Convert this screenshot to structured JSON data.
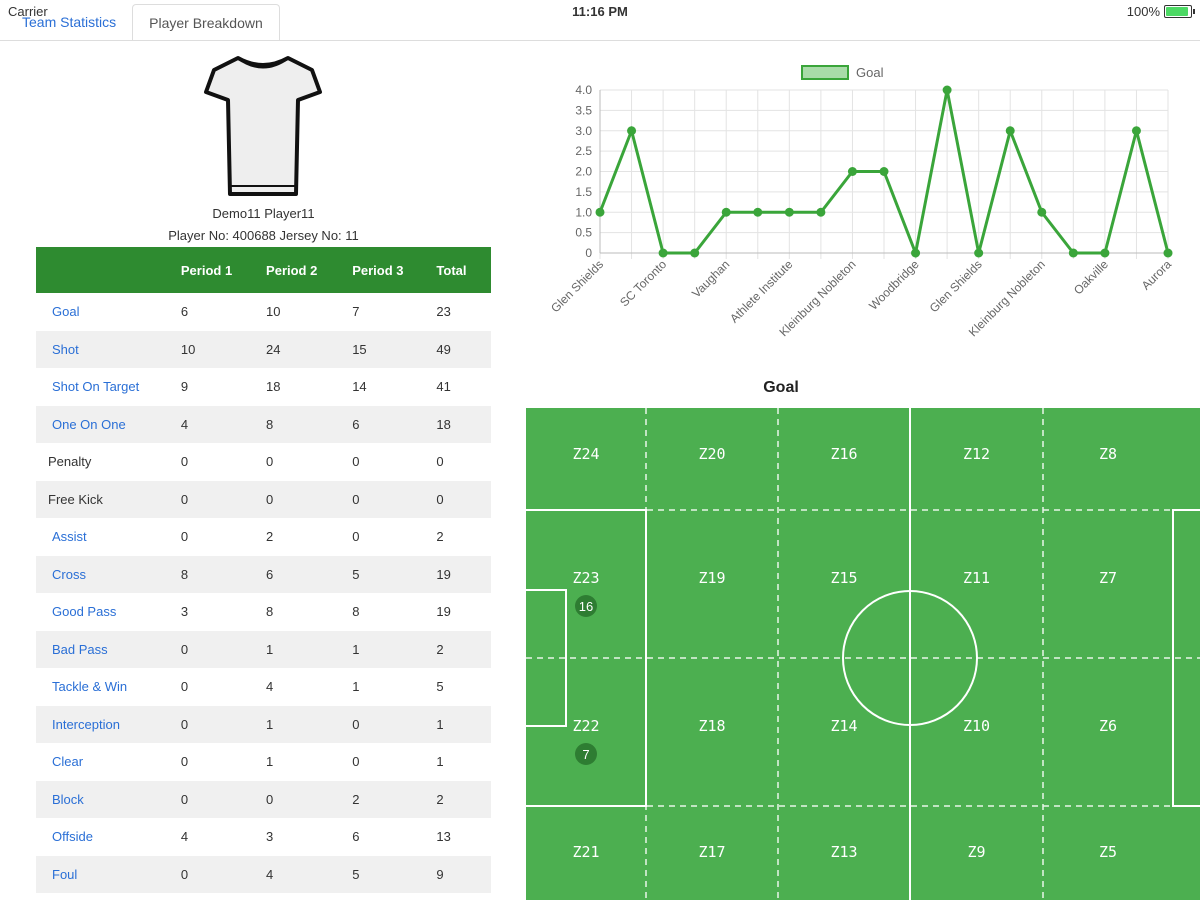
{
  "status": {
    "carrier": "Carrier",
    "time": "11:16 PM",
    "battery": "100%"
  },
  "tabs": [
    "Team Statistics",
    "Player Breakdown"
  ],
  "player": {
    "name": "Demo11 Player11",
    "info": "Player No: 400688 Jersey No: 11"
  },
  "table": {
    "headers": [
      "",
      "Period 1",
      "Period 2",
      "Period 3",
      "Total"
    ],
    "rows": [
      {
        "label": "Goal",
        "link": true,
        "values": [
          "6",
          "10",
          "7",
          "23"
        ]
      },
      {
        "label": "Shot",
        "link": true,
        "values": [
          "10",
          "24",
          "15",
          "49"
        ]
      },
      {
        "label": "Shot On Target",
        "link": true,
        "values": [
          "9",
          "18",
          "14",
          "41"
        ]
      },
      {
        "label": "One On One",
        "link": true,
        "values": [
          "4",
          "8",
          "6",
          "18"
        ]
      },
      {
        "label": "Penalty",
        "link": false,
        "values": [
          "0",
          "0",
          "0",
          "0"
        ]
      },
      {
        "label": "Free Kick",
        "link": false,
        "values": [
          "0",
          "0",
          "0",
          "0"
        ]
      },
      {
        "label": "Assist",
        "link": true,
        "values": [
          "0",
          "2",
          "0",
          "2"
        ]
      },
      {
        "label": "Cross",
        "link": true,
        "values": [
          "8",
          "6",
          "5",
          "19"
        ]
      },
      {
        "label": "Good Pass",
        "link": true,
        "values": [
          "3",
          "8",
          "8",
          "19"
        ]
      },
      {
        "label": "Bad Pass",
        "link": true,
        "values": [
          "0",
          "1",
          "1",
          "2"
        ]
      },
      {
        "label": "Tackle & Win",
        "link": true,
        "values": [
          "0",
          "4",
          "1",
          "5"
        ]
      },
      {
        "label": "Interception",
        "link": true,
        "values": [
          "0",
          "1",
          "0",
          "1"
        ]
      },
      {
        "label": "Clear",
        "link": true,
        "values": [
          "0",
          "1",
          "0",
          "1"
        ]
      },
      {
        "label": "Block",
        "link": true,
        "values": [
          "0",
          "0",
          "2",
          "2"
        ]
      },
      {
        "label": "Offside",
        "link": true,
        "values": [
          "4",
          "3",
          "6",
          "13"
        ]
      },
      {
        "label": "Foul",
        "link": true,
        "values": [
          "0",
          "4",
          "5",
          "9"
        ]
      }
    ]
  },
  "chart_data": {
    "type": "line",
    "series": [
      {
        "name": "Goal",
        "values": [
          1,
          3,
          0,
          0,
          1,
          1,
          1,
          1,
          2,
          2,
          0,
          4,
          0,
          3,
          1,
          0,
          0,
          3,
          0
        ]
      }
    ],
    "x_tick_labels": [
      "Glen Shields",
      "SC Toronto",
      "Vaughan",
      "Athlete Institute",
      "Kleinburg Nobleton",
      "Woodbridge",
      "Glen Shields",
      "Kleinburg Nobleton",
      "Oakville",
      "Aurora"
    ],
    "y_ticks": [
      "0",
      "0.5",
      "1.0",
      "1.5",
      "2.0",
      "2.5",
      "3.0",
      "3.5",
      "4.0"
    ],
    "ylim": [
      0,
      4
    ],
    "grid": true,
    "legend": "top",
    "color": "#3aa53a"
  },
  "pitch": {
    "title": "Goal",
    "color": "#4caf50",
    "zones": [
      [
        "Z24",
        "Z20",
        "Z16",
        "Z12",
        "Z8"
      ],
      [
        "Z23",
        "Z19",
        "Z15",
        "Z11",
        "Z7"
      ],
      [
        "Z22",
        "Z18",
        "Z14",
        "Z10",
        "Z6"
      ],
      [
        "Z21",
        "Z17",
        "Z13",
        "Z9",
        "Z5"
      ]
    ],
    "badges": [
      {
        "zone": "Z23",
        "count": "16"
      },
      {
        "zone": "Z22",
        "count": "7"
      }
    ]
  }
}
